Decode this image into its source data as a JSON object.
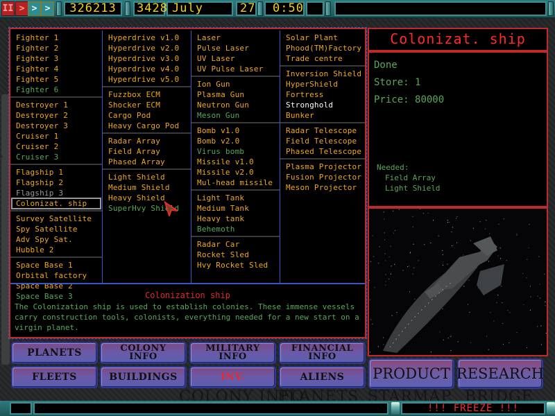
{
  "topbar": {
    "buttons": [
      {
        "name": "pause",
        "glyph": "II"
      },
      {
        "name": "play",
        "glyph": ">"
      },
      {
        "name": "fast",
        "glyph": ">"
      },
      {
        "name": "faster",
        "glyph": ">"
      }
    ],
    "credits": "326213",
    "year": "3428",
    "month": "July",
    "day": "27",
    "time": "0:50",
    "message": ""
  },
  "columns": [
    {
      "groups": [
        [
          {
            "label": "Fighter 1",
            "state": "built"
          },
          {
            "label": "Fighter 2",
            "state": "built"
          },
          {
            "label": "Fighter 3",
            "state": "built"
          },
          {
            "label": "Fighter 4",
            "state": "built"
          },
          {
            "label": "Fighter 5",
            "state": "built"
          },
          {
            "label": "Fighter 6",
            "state": "avail"
          }
        ],
        [
          {
            "label": "Destroyer 1",
            "state": "built"
          },
          {
            "label": "Destroyer 2",
            "state": "built"
          },
          {
            "label": "Destroyer 3",
            "state": "built"
          },
          {
            "label": "Cruiser 1",
            "state": "built"
          },
          {
            "label": "Cruiser 2",
            "state": "built"
          },
          {
            "label": "Cruiser 3",
            "state": "avail"
          }
        ],
        [
          {
            "label": "Flagship 1",
            "state": "built"
          },
          {
            "label": "Flagship 2",
            "state": "built"
          },
          {
            "label": "Flagship 3",
            "state": "gray"
          },
          {
            "label": "Colonizat. ship",
            "state": "selected"
          }
        ],
        [
          {
            "label": "Survey Satellite",
            "state": "built"
          },
          {
            "label": "Spy Satellite",
            "state": "built"
          },
          {
            "label": "Adv Spy Sat.",
            "state": "built"
          },
          {
            "label": "Hubble 2",
            "state": "built"
          }
        ],
        [
          {
            "label": "Space Base 1",
            "state": "built"
          },
          {
            "label": "Orbital factory",
            "state": "built"
          },
          {
            "label": "Space Base 2",
            "state": "built"
          },
          {
            "label": "Space Base 3",
            "state": "avail"
          }
        ]
      ]
    },
    {
      "groups": [
        [
          {
            "label": "Hyperdrive v1.0",
            "state": "built"
          },
          {
            "label": "Hyperdrive v2.0",
            "state": "built"
          },
          {
            "label": "Hyperdrive v3.0",
            "state": "built"
          },
          {
            "label": "Hyperdrive v4.0",
            "state": "built"
          },
          {
            "label": "Hyperdrive v5.0",
            "state": "built"
          }
        ],
        [
          {
            "label": "Fuzzbox ECM",
            "state": "built"
          },
          {
            "label": "Shocker ECM",
            "state": "built"
          },
          {
            "label": "Cargo Pod",
            "state": "built"
          },
          {
            "label": "Heavy Cargo Pod",
            "state": "built"
          }
        ],
        [
          {
            "label": "Radar Array",
            "state": "built"
          },
          {
            "label": "Field Array",
            "state": "built"
          },
          {
            "label": "Phased Array",
            "state": "built"
          }
        ],
        [
          {
            "label": "Light Shield",
            "state": "built"
          },
          {
            "label": "Medium Shield",
            "state": "built"
          },
          {
            "label": "Heavy Shield",
            "state": "built"
          },
          {
            "label": "SuperHvy Shield",
            "state": "avail"
          }
        ]
      ]
    },
    {
      "groups": [
        [
          {
            "label": "Laser",
            "state": "built"
          },
          {
            "label": "Pulse Laser",
            "state": "built"
          },
          {
            "label": "UV Laser",
            "state": "built"
          },
          {
            "label": "UV Pulse Laser",
            "state": "built"
          }
        ],
        [
          {
            "label": "Ion Gun",
            "state": "built"
          },
          {
            "label": "Plasma Gun",
            "state": "built"
          },
          {
            "label": "Neutron Gun",
            "state": "built"
          },
          {
            "label": "Meson Gun",
            "state": "avail"
          }
        ],
        [
          {
            "label": "Bomb v1.0",
            "state": "built"
          },
          {
            "label": "Bomb v2.0",
            "state": "built"
          },
          {
            "label": "Virus bomb",
            "state": "avail"
          },
          {
            "label": "Missile v1.0",
            "state": "built"
          },
          {
            "label": "Missile v2.0",
            "state": "built"
          },
          {
            "label": "Mul-head missile",
            "state": "built"
          }
        ],
        [
          {
            "label": "Light Tank",
            "state": "built"
          },
          {
            "label": "Medium Tank",
            "state": "built"
          },
          {
            "label": "Heavy tank",
            "state": "built"
          },
          {
            "label": "Behemoth",
            "state": "avail"
          }
        ],
        [
          {
            "label": "Radar Car",
            "state": "built"
          },
          {
            "label": "Rocket Sled",
            "state": "built"
          },
          {
            "label": "Hvy Rocket Sled",
            "state": "built"
          }
        ]
      ]
    },
    {
      "groups": [
        [
          {
            "label": "Solar Plant",
            "state": "built"
          },
          {
            "label": "Phood(TM)Factory",
            "state": "built"
          },
          {
            "label": "Trade centre",
            "state": "built"
          }
        ],
        [
          {
            "label": "Inversion Shield",
            "state": "built"
          },
          {
            "label": "HyperShield",
            "state": "built"
          },
          {
            "label": "Fortress",
            "state": "built"
          },
          {
            "label": "Stronghold",
            "state": "white"
          },
          {
            "label": "Bunker",
            "state": "built"
          }
        ],
        [
          {
            "label": "Radar Telescope",
            "state": "built"
          },
          {
            "label": "Field Telescope",
            "state": "built"
          },
          {
            "label": "Phased Telescope",
            "state": "built"
          }
        ],
        [
          {
            "label": "Plasma Projector",
            "state": "built"
          },
          {
            "label": "Fusion Projector",
            "state": "built"
          },
          {
            "label": "Meson Projector",
            "state": "built"
          }
        ]
      ]
    }
  ],
  "description": {
    "title": "Colonization ship",
    "text": "The Colonization ship is used to establish colonies. These immense vessels carry construction tools, colonists, everything needed for a new start on a virgin planet."
  },
  "info": {
    "title": "Colonizat. ship",
    "status": "Done",
    "store_label": "Store:",
    "store_value": "1",
    "price_label": "Price:",
    "price_value": "80000",
    "needed_label": "Needed:",
    "needed": [
      "Field Array",
      "Light Shield"
    ]
  },
  "nav": {
    "row1": [
      {
        "label1": "PLANETS",
        "label2": ""
      },
      {
        "label1": "COLONY",
        "label2": "INFO"
      },
      {
        "label1": "MILITARY",
        "label2": "INFO"
      },
      {
        "label1": "FINANCIAL",
        "label2": "INFO"
      }
    ],
    "row2": [
      {
        "label1": "FLEETS",
        "label2": ""
      },
      {
        "label1": "BUILDINGS",
        "label2": ""
      },
      {
        "label1": "INV.",
        "label2": "",
        "active": true
      },
      {
        "label1": "ALIENS",
        "label2": ""
      }
    ],
    "product": "PRODUCT",
    "research": "RESEARCH"
  },
  "ghost_labels": [
    "COLONY INFO",
    "PLANETS",
    "STARMAP",
    "BRIDGE"
  ],
  "status": {
    "message": "!!! FREEZE !!!"
  },
  "colors": {
    "built": "#f0a81b",
    "available": "#58a85a",
    "accent_red": "#e42a2a",
    "lcd_yellow": "#f2d11c"
  }
}
